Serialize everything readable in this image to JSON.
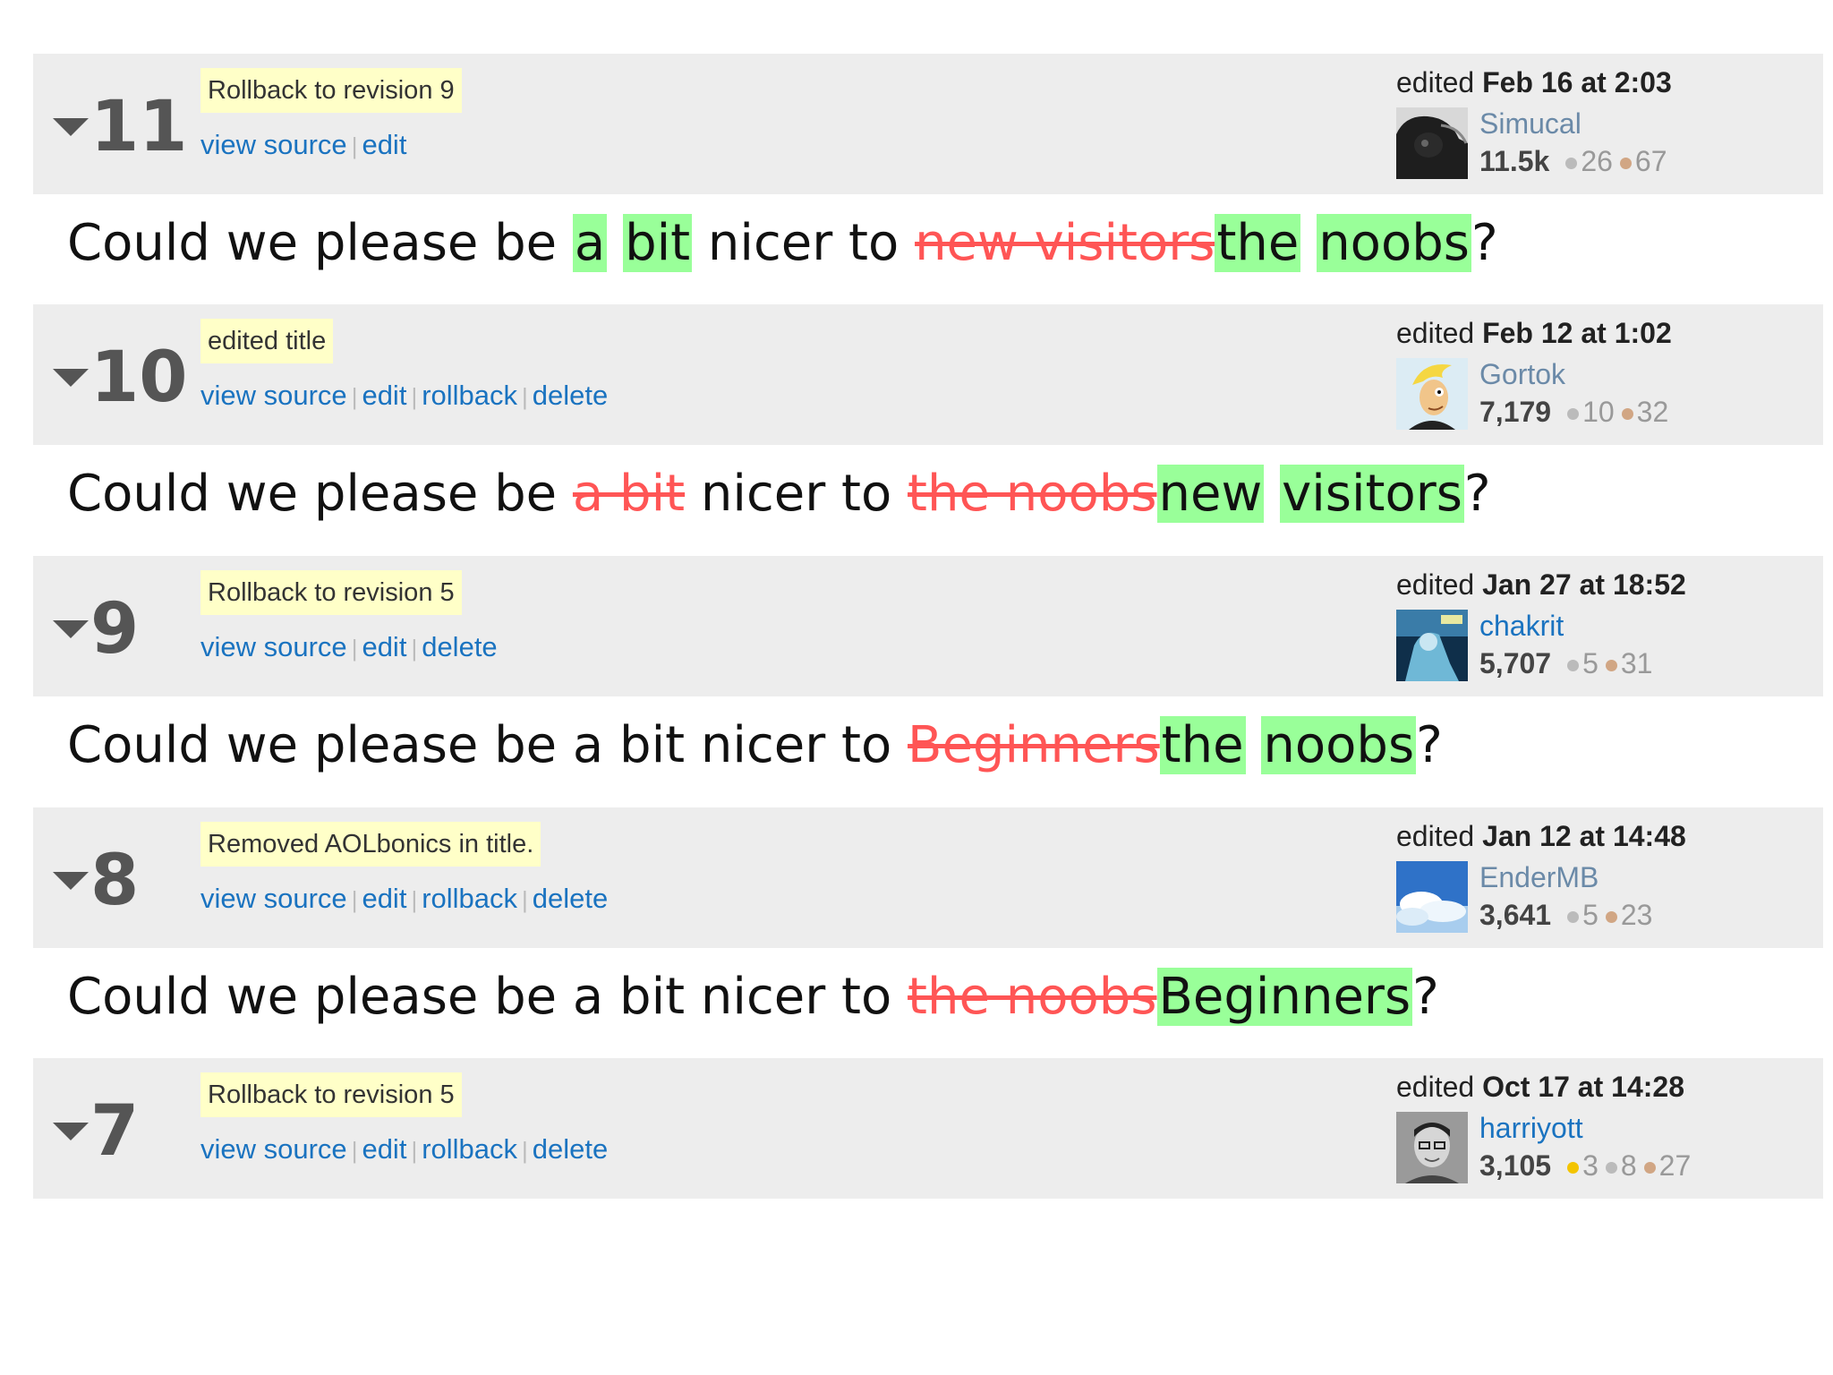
{
  "link_labels": {
    "view_source": "view source",
    "edit": "edit",
    "rollback": "rollback",
    "delete": "delete"
  },
  "edited_prefix": "edited",
  "colors": {
    "insert_bg": "#99ff99",
    "delete_fg": "#ff5555",
    "comment_bg": "#ffffc8",
    "link": "#1a73c0",
    "header_bg": "#ededed"
  },
  "revisions": [
    {
      "number": "11",
      "comment": "Rollback to revision 9",
      "edited_when": "Feb 16 at 2:03",
      "user": "Simucal",
      "reputation": "11.5k",
      "badges": {
        "silver": "26",
        "bronze": "67"
      },
      "title_segments": [
        {
          "t": "Could we please be ",
          "k": "plain"
        },
        {
          "t": "a",
          "k": "ins"
        },
        {
          "t": " ",
          "k": "plain"
        },
        {
          "t": "bit",
          "k": "ins"
        },
        {
          "t": " nicer to ",
          "k": "plain"
        },
        {
          "t": "new visitors",
          "k": "del"
        },
        {
          "t": "the",
          "k": "ins"
        },
        {
          "t": " ",
          "k": "plain"
        },
        {
          "t": "noobs",
          "k": "ins"
        },
        {
          "t": "?",
          "k": "plain"
        }
      ]
    },
    {
      "number": "10",
      "comment": "edited title",
      "edited_when": "Feb 12 at 1:02",
      "user": "Gortok",
      "reputation": "7,179",
      "badges": {
        "silver": "10",
        "bronze": "32"
      },
      "title_segments": [
        {
          "t": "Could we please be ",
          "k": "plain"
        },
        {
          "t": "a bit",
          "k": "del"
        },
        {
          "t": " nicer to ",
          "k": "plain"
        },
        {
          "t": "the noobs",
          "k": "del"
        },
        {
          "t": "new",
          "k": "ins"
        },
        {
          "t": " ",
          "k": "plain"
        },
        {
          "t": "visitors",
          "k": "ins"
        },
        {
          "t": "?",
          "k": "plain"
        }
      ]
    },
    {
      "number": "9",
      "comment": "Rollback to revision 5",
      "edited_when": "Jan 27 at 18:52",
      "user": "chakrit",
      "reputation": "5,707",
      "badges": {
        "silver": "5",
        "bronze": "31"
      },
      "title_segments": [
        {
          "t": "Could we please be a bit nicer to ",
          "k": "plain"
        },
        {
          "t": "Beginners",
          "k": "del"
        },
        {
          "t": "the",
          "k": "ins"
        },
        {
          "t": " ",
          "k": "plain"
        },
        {
          "t": "noobs",
          "k": "ins"
        },
        {
          "t": "?",
          "k": "plain"
        }
      ]
    },
    {
      "number": "8",
      "comment": "Removed AOLbonics in title.",
      "edited_when": "Jan 12 at 14:48",
      "user": "EnderMB",
      "reputation": "3,641",
      "badges": {
        "silver": "5",
        "bronze": "23"
      },
      "title_segments": [
        {
          "t": "Could we please be a bit nicer to ",
          "k": "plain"
        },
        {
          "t": "the noobs",
          "k": "del"
        },
        {
          "t": "Beginners",
          "k": "ins"
        },
        {
          "t": "?",
          "k": "plain"
        }
      ]
    },
    {
      "number": "7",
      "comment": "Rollback to revision 5",
      "edited_when": "Oct 17 at 14:28",
      "user": "harriyott",
      "reputation": "3,105",
      "badges": {
        "gold": "3",
        "silver": "8",
        "bronze": "27"
      }
    }
  ]
}
